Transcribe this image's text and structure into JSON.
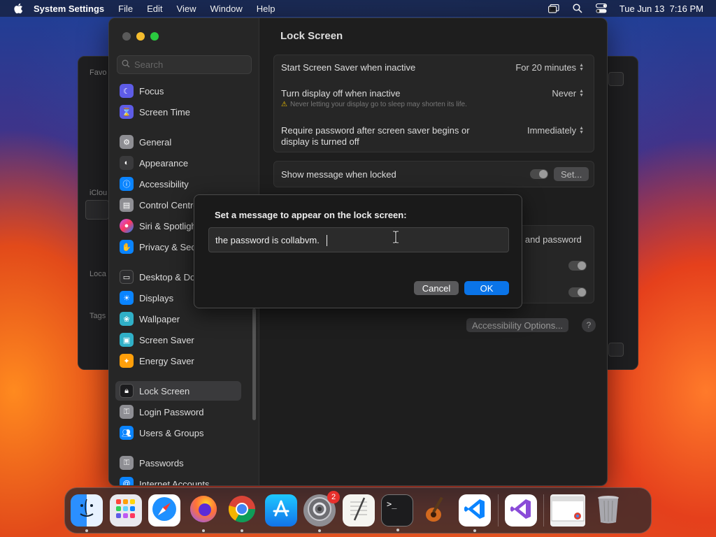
{
  "menubar": {
    "app_name": "System Settings",
    "menus": [
      "File",
      "Edit",
      "View",
      "Window",
      "Help"
    ],
    "datetime": "Tue Jun 13  7:16 PM"
  },
  "background_window": {
    "labels": [
      "Favo",
      "iClou",
      "Loca",
      "Tags"
    ]
  },
  "sidebar": {
    "search_placeholder": "Search",
    "items": [
      {
        "label": "Focus",
        "color": "#5e5ce6",
        "icon": "moon-icon"
      },
      {
        "label": "Screen Time",
        "color": "#5e5ce6",
        "icon": "hourglass-icon"
      },
      {
        "label": "General",
        "color": "#8e8e93",
        "icon": "gear-icon"
      },
      {
        "label": "Appearance",
        "color": "#3a3a3c",
        "icon": "appearance-icon"
      },
      {
        "label": "Accessibility",
        "color": "#0a84ff",
        "icon": "accessibility-icon"
      },
      {
        "label": "Control Centre",
        "color": "#8e8e93",
        "icon": "control-centre-icon"
      },
      {
        "label": "Siri & Spotlight",
        "color": "#bf5af2",
        "icon": "siri-icon"
      },
      {
        "label": "Privacy & Security",
        "color": "#0a84ff",
        "icon": "hand-icon"
      },
      {
        "label": "Desktop & Dock",
        "color": "#2c2c2e",
        "icon": "desktop-icon"
      },
      {
        "label": "Displays",
        "color": "#0a84ff",
        "icon": "displays-icon"
      },
      {
        "label": "Wallpaper",
        "color": "#30b0c7",
        "icon": "wallpaper-icon"
      },
      {
        "label": "Screen Saver",
        "color": "#30b0c7",
        "icon": "screen-saver-icon"
      },
      {
        "label": "Energy Saver",
        "color": "#ff9f0a",
        "icon": "lightbulb-icon"
      },
      {
        "label": "Lock Screen",
        "color": "#2c2c2e",
        "icon": "lock-icon"
      },
      {
        "label": "Login Password",
        "color": "#8e8e93",
        "icon": "key-icon"
      },
      {
        "label": "Users & Groups",
        "color": "#0a84ff",
        "icon": "users-icon"
      },
      {
        "label": "Passwords",
        "color": "#8e8e93",
        "icon": "key-icon"
      },
      {
        "label": "Internet Accounts",
        "color": "#0a84ff",
        "icon": "at-icon"
      }
    ]
  },
  "content": {
    "title": "Lock Screen",
    "screen_saver": {
      "label": "Start Screen Saver when inactive",
      "value": "For 20 minutes"
    },
    "display_off": {
      "label": "Turn display off when inactive",
      "value": "Never",
      "warning": "Never letting your display go to sleep may shorten its life."
    },
    "require_password": {
      "label_line1": "Require password after screen saver begins or",
      "label_line2": "display is turned off",
      "value": "Immediately"
    },
    "show_message": {
      "label": "Show message when locked",
      "button": "Set..."
    },
    "partial_label": "e and password",
    "accessibility_options": "Accessibility Options...",
    "help": "?"
  },
  "dialog": {
    "title": "Set a message to appear on the lock screen:",
    "input_value": "the password is collabvm.",
    "cancel": "Cancel",
    "ok": "OK"
  },
  "dock": {
    "badge_count": "2"
  },
  "colors": {
    "accent": "#0a74e8",
    "badge": "#e8302c"
  }
}
